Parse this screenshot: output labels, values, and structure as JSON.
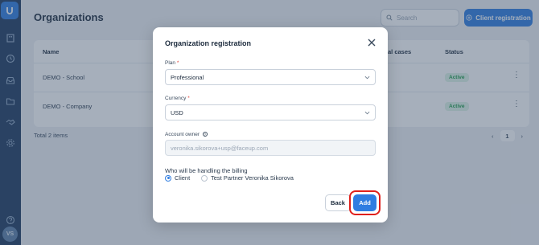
{
  "sidebar": {
    "avatar_initials": "VS",
    "icons": [
      "logo-icon",
      "building-icon",
      "clock-icon",
      "inbox-icon",
      "folder-icon",
      "handshake-icon",
      "gear-icon",
      "help-icon"
    ]
  },
  "page": {
    "title": "Organizations",
    "search_placeholder": "Search",
    "client_registration_label": "Client registration",
    "table": {
      "headers": {
        "name": "Name",
        "cases": "al cases",
        "status": "Status"
      },
      "rows": [
        {
          "name": "DEMO - School",
          "status": "Active"
        },
        {
          "name": "DEMO - Company",
          "status": "Active"
        }
      ]
    },
    "total_label": "Total 2 items",
    "pagination": {
      "prev": "‹",
      "current": "1",
      "next": "›"
    }
  },
  "modal": {
    "title": "Organization registration",
    "plan": {
      "label": "Plan",
      "required_mark": "*",
      "value": "Professional"
    },
    "currency": {
      "label": "Currency",
      "required_mark": "*",
      "value": "USD"
    },
    "account_owner": {
      "label": "Account owner",
      "value": "veronika.sikorova+usp@faceup.com"
    },
    "billing": {
      "question": "Who will be handling the billing",
      "options": [
        {
          "label": "Client",
          "selected": true
        },
        {
          "label": "Test Partner Veronika Sikorova",
          "selected": false
        }
      ]
    },
    "back_label": "Back",
    "add_label": "Add"
  },
  "colors": {
    "accent": "#2f7de1",
    "sidebar": "#1e3a5f",
    "highlight": "#e0201b",
    "status_active": "#1f9d4c"
  }
}
